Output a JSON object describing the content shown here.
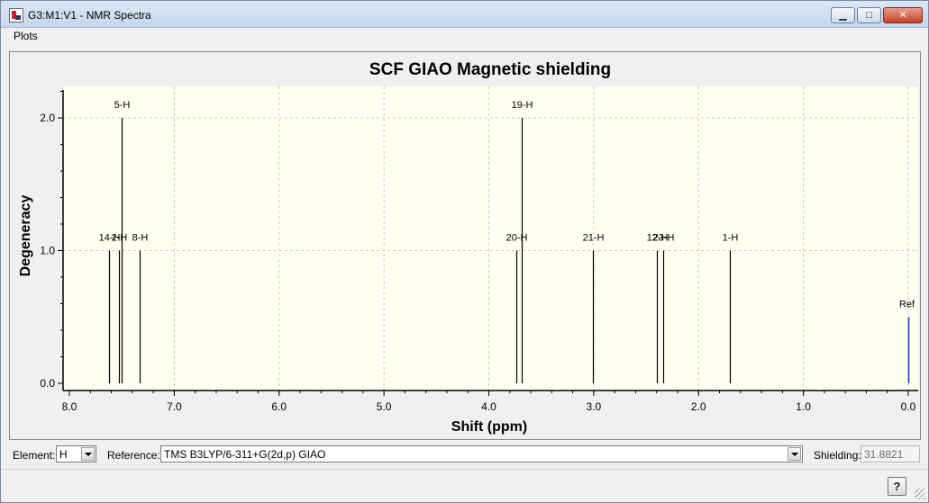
{
  "window": {
    "title": "G3:M1:V1 - NMR Spectra",
    "icon": "nmr-spectra-app-icon",
    "controls": [
      "minimize-icon",
      "maximize-icon",
      "close-icon"
    ]
  },
  "menu": {
    "plots_label": "Plots"
  },
  "chart_data": {
    "type": "bar",
    "title": "SCF GIAO Magnetic shielding",
    "xlabel": "Shift (ppm)",
    "ylabel": "Degeneracy",
    "xlim": [
      8.0,
      0.0
    ],
    "ylim": [
      0.0,
      2.2
    ],
    "x_reversed": true,
    "x_ticks": [
      "8.0",
      "7.0",
      "6.0",
      "5.0",
      "4.0",
      "3.0",
      "2.0",
      "1.0",
      "0.0"
    ],
    "y_ticks": [
      "0.0",
      "1.0",
      "2.0"
    ],
    "grid": true,
    "peaks": [
      {
        "label": "14-H",
        "x": 7.62,
        "y": 1.0
      },
      {
        "label": "2-H",
        "x": 7.53,
        "y": 1.0
      },
      {
        "label": "5-H",
        "x": 7.5,
        "y": 2.0
      },
      {
        "label": "8-H",
        "x": 7.33,
        "y": 1.0
      },
      {
        "label": "20-H",
        "x": 3.74,
        "y": 1.0
      },
      {
        "label": "19-H",
        "x": 3.69,
        "y": 2.0
      },
      {
        "label": "21-H",
        "x": 3.01,
        "y": 1.0
      },
      {
        "label": "12-H",
        "x": 2.4,
        "y": 1.0
      },
      {
        "label": "23-H",
        "x": 2.34,
        "y": 1.0
      },
      {
        "label": "1-H",
        "x": 1.7,
        "y": 1.0
      },
      {
        "label": "Ref",
        "x": 0.0,
        "y": 0.5,
        "is_reference": true
      }
    ],
    "colors": {
      "plot_bg": "#fffff2",
      "grid": "#c8c8c8",
      "bar": "#000000",
      "ref_bar": "#1f2fbf"
    }
  },
  "controls": {
    "element_label": "Element:",
    "element_value": "H",
    "reference_label": "Reference:",
    "reference_value": "TMS B3LYP/6-311+G(2d,p) GIAO",
    "shielding_label": "Shielding:",
    "shielding_value": "31.8821"
  },
  "help_button": {
    "label": "?"
  }
}
